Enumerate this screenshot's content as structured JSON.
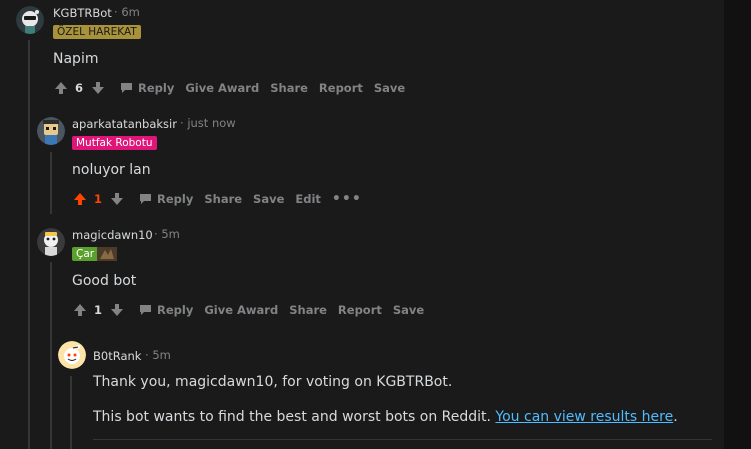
{
  "comments": [
    {
      "username": "KGBTRBot",
      "time": "6m",
      "flair": "ÖZEL HAREKAT",
      "text": "Napim",
      "score": "6",
      "actions": [
        "Reply",
        "Give Award",
        "Share",
        "Report",
        "Save"
      ]
    },
    {
      "username": "aparkatatanbaksir",
      "time": "just now",
      "flair": "Mutfak Robotu",
      "text": "noluyor lan",
      "score": "1",
      "actions": [
        "Reply",
        "Share",
        "Save",
        "Edit"
      ]
    },
    {
      "username": "magicdawn10",
      "time": "5m",
      "flair": "Çar",
      "text": "Good bot",
      "score": "1",
      "actions": [
        "Reply",
        "Give Award",
        "Share",
        "Report",
        "Save"
      ]
    },
    {
      "username": "B0tRank",
      "time": "5m",
      "text_line1": "Thank you, magicdawn10, for voting on KGBTRBot.",
      "text_line2_prefix": "This bot wants to find the best and worst bots on Reddit. ",
      "text_line2_link": "You can view results here",
      "text_line2_suffix": "."
    }
  ],
  "colors": {
    "background": "#1a1a1b",
    "text": "#d7dadc",
    "muted": "#818384",
    "upvote_active": "#ff4500",
    "link": "#4fbcff",
    "flair_ozel": "#a8933a",
    "flair_mutfak": "#e0157a",
    "flair_car": "#5aa02c"
  },
  "icons": [
    "upvote-icon",
    "downvote-icon",
    "comment-reply-icon",
    "more-options-icon"
  ]
}
